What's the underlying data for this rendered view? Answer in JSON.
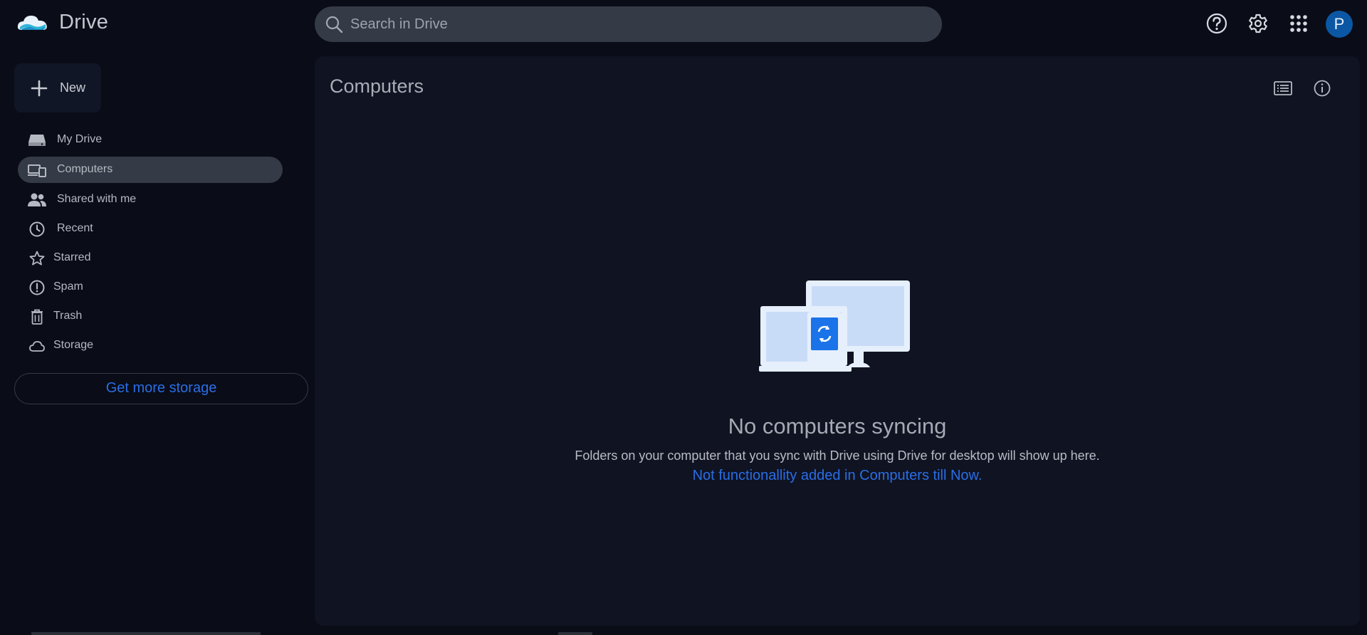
{
  "header": {
    "app_title": "Drive",
    "search_placeholder": "Search in Drive",
    "avatar_letter": "P"
  },
  "sidebar": {
    "new_label": "New",
    "items": [
      {
        "label": "My Drive",
        "icon": "drive-icon",
        "active": false
      },
      {
        "label": "Computers",
        "icon": "computers-icon",
        "active": true
      },
      {
        "label": "Shared with me",
        "icon": "people-icon",
        "active": false
      },
      {
        "label": "Recent",
        "icon": "clock-icon",
        "active": false
      },
      {
        "label": "Starred",
        "icon": "star-icon",
        "active": false
      },
      {
        "label": "Spam",
        "icon": "spam-icon",
        "active": false
      },
      {
        "label": "Trash",
        "icon": "trash-icon",
        "active": false
      },
      {
        "label": "Storage",
        "icon": "cloud-icon",
        "active": false
      }
    ],
    "get_storage_label": "Get more storage"
  },
  "main": {
    "title": "Computers",
    "empty_title": "No computers syncing",
    "empty_desc": "Folders on your computer that you sync with Drive using Drive for desktop will show up here.",
    "empty_note": "Not functionallity added in Computers till Now."
  },
  "colors": {
    "background": "#0a0c17",
    "panel": "#0f1322",
    "search_bg": "#343a46",
    "active_nav": "#343a46",
    "link": "#2a6ee6",
    "avatar": "#0b57a4"
  }
}
